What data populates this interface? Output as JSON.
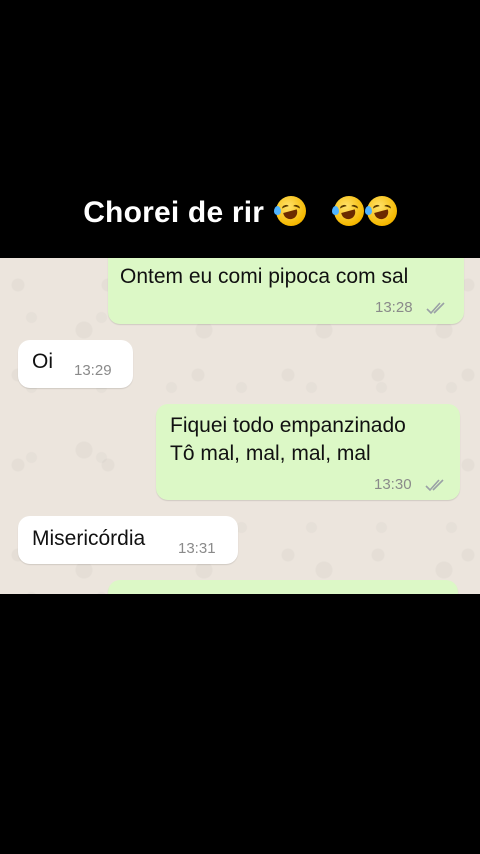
{
  "caption": {
    "text": "Chorei de rir",
    "emoji": "rolling-on-floor-laughing-emoji"
  },
  "messages": [
    {
      "direction": "out",
      "lines": [
        "Ontem eu comi pipoca com sal"
      ],
      "time": "13:28",
      "status": "double-check-icon"
    },
    {
      "direction": "in",
      "lines": [
        "Oi"
      ],
      "time": "13:29"
    },
    {
      "direction": "out",
      "lines": [
        "Fiquei todo empanzinado",
        "Tô mal, mal, mal, mal"
      ],
      "time": "13:30",
      "status": "double-check-icon"
    },
    {
      "direction": "in",
      "lines": [
        "Misericórdia"
      ],
      "time": "13:31"
    }
  ],
  "colors": {
    "outgoing": "#dcf8c6",
    "incoming": "#ffffff",
    "chat_bg": "#ece5dd",
    "background": "#000000"
  }
}
